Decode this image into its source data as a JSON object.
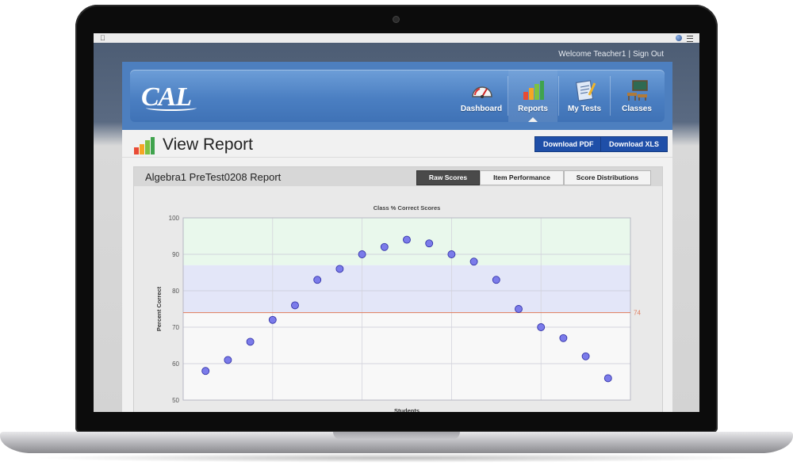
{
  "os": {
    "welcome_text": "Welcome Teacher1",
    "separator": "|",
    "sign_out": "Sign Out"
  },
  "logo": {
    "text": "CAL"
  },
  "nav": [
    {
      "label": "Dashboard",
      "icon": "dashboard-gauge-icon",
      "active": false
    },
    {
      "label": "Reports",
      "icon": "bar-chart-icon",
      "active": true
    },
    {
      "label": "My Tests",
      "icon": "test-document-icon",
      "active": false
    },
    {
      "label": "Classes",
      "icon": "classroom-icon",
      "active": false
    }
  ],
  "page": {
    "title": "View Report",
    "download_pdf": "Download PDF",
    "download_xls": "Download XLS",
    "report_name": "Algebra1 PreTest0208 Report"
  },
  "tabs": [
    {
      "label": "Raw Scores",
      "active": true
    },
    {
      "label": "Item Performance",
      "active": false
    },
    {
      "label": "Score Distributions",
      "active": false
    }
  ],
  "colors": {
    "accent": "#4d7fbf",
    "band_green": "#e9f8ec",
    "band_blue": "#e3e6f8",
    "band_plain": "#f8f8f8",
    "point_fill": "#7b7bea",
    "point_stroke": "#3434a8",
    "threshold_line": "#e07a5a"
  },
  "chart_data": {
    "type": "scatter",
    "title": "Class % Correct Scores",
    "xlabel": "Students",
    "ylabel": "Percent Correct",
    "ylim": [
      50,
      100
    ],
    "yticks": [
      50,
      60,
      70,
      80,
      90,
      100
    ],
    "x": [
      1,
      2,
      3,
      4,
      5,
      6,
      7,
      8,
      9,
      10,
      11,
      12,
      13,
      14,
      15,
      16,
      17,
      18,
      19
    ],
    "values": [
      58,
      61,
      66,
      72,
      76,
      83,
      86,
      90,
      92,
      94,
      93,
      90,
      88,
      83,
      75,
      70,
      67,
      62,
      56
    ],
    "bands": [
      {
        "from": 87,
        "to": 100,
        "color": "green"
      },
      {
        "from": 74,
        "to": 87,
        "color": "blue"
      },
      {
        "from": 50,
        "to": 74,
        "color": "plain"
      }
    ],
    "threshold": {
      "value": 74,
      "label": "74"
    },
    "grid": true
  }
}
